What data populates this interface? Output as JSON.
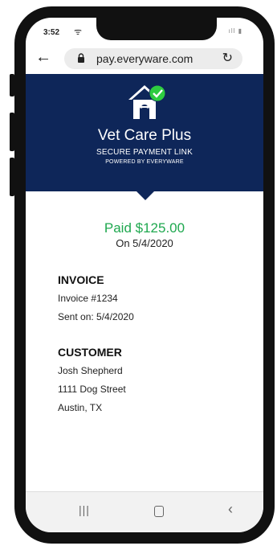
{
  "status": {
    "time": "3:52",
    "signal": "ıll ▮"
  },
  "browser": {
    "url": "pay.everyware.com"
  },
  "header": {
    "brand": "Vet Care Plus",
    "tagline": "SECURE PAYMENT LINK",
    "powered": "POWERED BY EVERYWARE"
  },
  "payment": {
    "status": "Paid $125.00",
    "date": "On 5/4/2020"
  },
  "invoice": {
    "title": "INVOICE",
    "number": "Invoice #1234",
    "sent": "Sent on: 5/4/2020"
  },
  "customer": {
    "title": "CUSTOMER",
    "name": "Josh Shepherd",
    "street": "1111 Dog Street",
    "city": "Austin, TX"
  },
  "colors": {
    "header_bg": "#0e2659",
    "paid_green": "#1fa84f",
    "check_green": "#2ecc40"
  },
  "icons": {
    "back": "back-arrow-icon",
    "lock": "lock-icon",
    "reload": "reload-icon",
    "logo": "doghouse-check-icon",
    "nav_recents": "recents-icon",
    "nav_home": "home-icon",
    "nav_back": "nav-back-icon"
  }
}
